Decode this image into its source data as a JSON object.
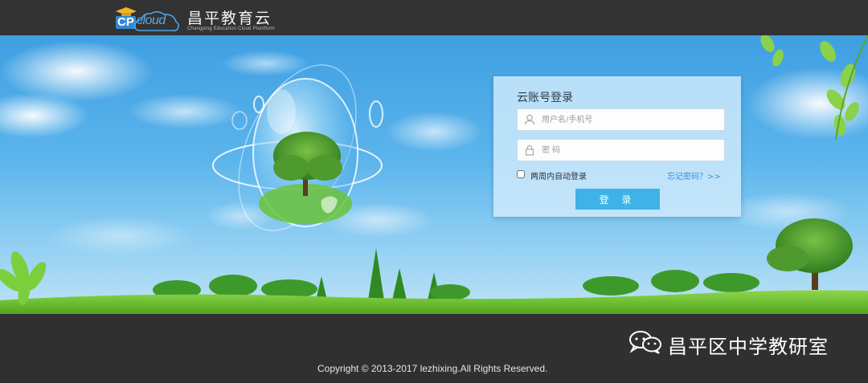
{
  "header": {
    "logo_cp": "CP",
    "logo_cloud": "cloud",
    "logo_cn": "昌平教育云",
    "logo_en": "Changping Education Cloud  Plantform"
  },
  "login": {
    "title": "云账号登录",
    "username_placeholder": "用户名/手机号",
    "password_placeholder": "密 码",
    "remember_label": "两周内自动登录",
    "forgot_label": "忘记密码？>>",
    "submit_label": "登 录",
    "username_icon": "user-icon",
    "password_icon": "lock-icon"
  },
  "footer": {
    "watermark": "昌平区中学教研室",
    "watermark_icon": "wechat-icon",
    "copyright": "Copyright © 2013-2017 lezhixing.All Rights Reserved."
  },
  "colors": {
    "header_bg": "#333333",
    "footer_bg": "#303030",
    "accent": "#3fb3e8",
    "link": "#3a8fd8",
    "sky": "#4aa8e6"
  }
}
